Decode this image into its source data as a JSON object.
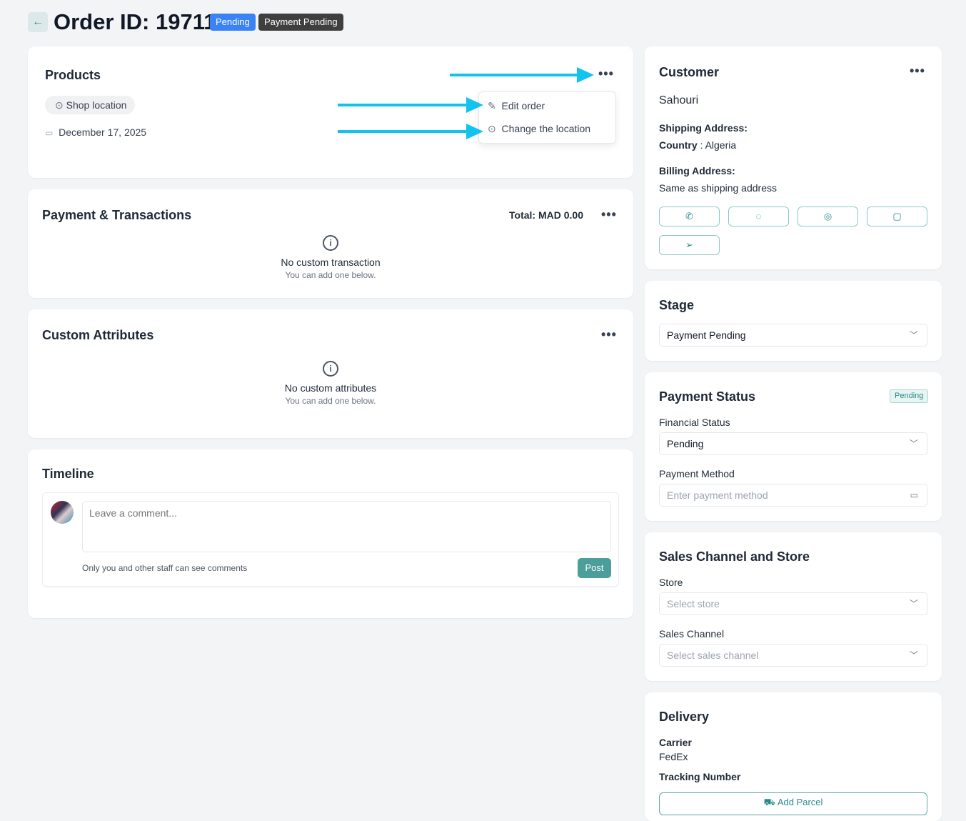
{
  "header": {
    "title": "Order ID: 19711",
    "badge_status": "Pending",
    "badge_stage": "Payment Pending"
  },
  "products": {
    "title": "Products",
    "location": "Shop location",
    "date": "December 17, 2025",
    "menu": [
      "Edit order",
      "Change the location"
    ]
  },
  "payment": {
    "title": "Payment & Transactions",
    "total": "Total: MAD 0.00",
    "empty_title": "No custom transaction",
    "empty_sub": "You can add one below."
  },
  "attributes": {
    "title": "Custom Attributes",
    "empty_title": "No custom attributes",
    "empty_sub": "You can add one below."
  },
  "timeline": {
    "title": "Timeline",
    "placeholder": "Leave a comment...",
    "note": "Only you and other staff can see comments",
    "post": "Post"
  },
  "customer": {
    "title": "Customer",
    "name": "Sahouri",
    "shipping_label": "Shipping Address:",
    "country_label": "Country",
    "country": ": Algeria",
    "billing_label": "Billing Address:",
    "billing": "Same as shipping address"
  },
  "stage": {
    "title": "Stage",
    "value": "Payment Pending"
  },
  "payment_status": {
    "title": "Payment Status",
    "badge": "Pending",
    "financial_label": "Financial Status",
    "financial_value": "Pending",
    "method_label": "Payment Method",
    "method_placeholder": "Enter payment method"
  },
  "sales": {
    "title": "Sales Channel and Store",
    "store_label": "Store",
    "store_placeholder": "Select store",
    "channel_label": "Sales Channel",
    "channel_placeholder": "Select sales channel"
  },
  "delivery": {
    "title": "Delivery",
    "carrier_label": "Carrier",
    "carrier": "FedEx",
    "tracking_label": "Tracking Number",
    "add_parcel": "Add Parcel"
  },
  "colors": {
    "accent": "#2a8a8a",
    "annotation": "#12c3f0",
    "badge_blue": "#3b82f6",
    "badge_dark": "#3f3f3f"
  }
}
